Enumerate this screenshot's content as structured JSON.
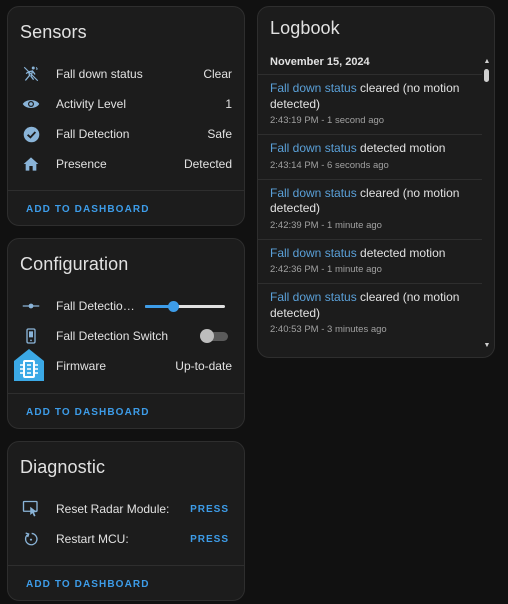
{
  "sensors": {
    "title": "Sensors",
    "rows": [
      {
        "icon": "fall-down-icon",
        "label": "Fall down status",
        "value": "Clear"
      },
      {
        "icon": "eye-icon",
        "label": "Activity Level",
        "value": "1"
      },
      {
        "icon": "check-circle-icon",
        "label": "Fall Detection",
        "value": "Safe"
      },
      {
        "icon": "home-icon",
        "label": "Presence",
        "value": "Detected"
      }
    ],
    "footer": "ADD TO DASHBOARD"
  },
  "configuration": {
    "title": "Configuration",
    "rows": [
      {
        "icon": "slider-icon",
        "label": "Fall Detection ...",
        "slider_level": 0.35
      },
      {
        "icon": "phone-icon",
        "label": "Fall Detection Switch",
        "toggle_on": false
      },
      {
        "icon": "chip-icon",
        "label": "Firmware",
        "value": "Up-to-date"
      }
    ],
    "footer": "ADD TO DASHBOARD"
  },
  "diagnostic": {
    "title": "Diagnostic",
    "rows": [
      {
        "icon": "touch-reset-icon",
        "label": "Reset Radar Module:",
        "action": "PRESS"
      },
      {
        "icon": "restart-icon",
        "label": "Restart MCU:",
        "action": "PRESS"
      }
    ],
    "footer": "ADD TO DASHBOARD"
  },
  "logbook": {
    "title": "Logbook",
    "date": "November 15, 2024",
    "entries": [
      {
        "entity": "Fall down status",
        "text": " cleared (no motion detected)",
        "time": "2:43:19 PM - 1 second ago"
      },
      {
        "entity": "Fall down status",
        "text": " detected motion",
        "time": "2:43:14 PM - 6 seconds ago"
      },
      {
        "entity": "Fall down status",
        "text": " cleared (no motion detected)",
        "time": "2:42:39 PM - 1 minute ago"
      },
      {
        "entity": "Fall down status",
        "text": " detected motion",
        "time": "2:42:36 PM - 1 minute ago"
      },
      {
        "entity": "Fall down status",
        "text": " cleared (no motion detected)",
        "time": "2:40:53 PM - 3 minutes ago"
      }
    ]
  },
  "colors": {
    "accent": "#3d9ce8",
    "entity_link": "#5aa0d8",
    "icon": "#8ab4d8",
    "card_bg": "#1c1c1c",
    "page_bg": "#111111",
    "app_badge": "#3ba9e6"
  }
}
